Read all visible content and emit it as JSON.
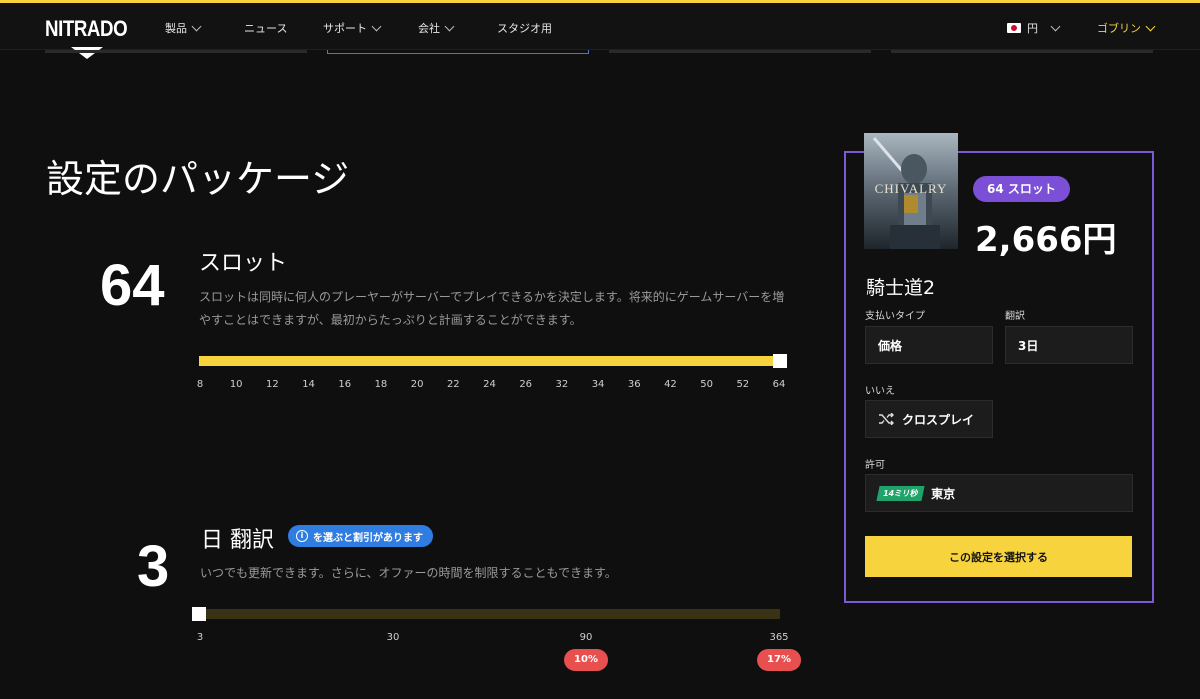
{
  "nav": {
    "logo": "NITRADO",
    "items": [
      {
        "label": "製品",
        "dropdown": true
      },
      {
        "label": "ニュース",
        "dropdown": false
      },
      {
        "label": "サポート",
        "dropdown": true
      },
      {
        "label": "会社",
        "dropdown": true
      },
      {
        "label": "スタジオ用",
        "dropdown": false
      }
    ],
    "currency": "円",
    "user": "ゴブリン",
    "accent_color": "#f7d33e"
  },
  "page_title": "設定のパッケージ",
  "slots": {
    "value": "64",
    "title": "スロット",
    "description_line1": "スロットは同時に何人のプレーヤーがサーバーでプレイできるかを決定します。将来的にゲームサーバーを増",
    "description_line2": "やすことはできますが、最初からたっぷりと計画することができます。",
    "ticks": [
      "8",
      "10",
      "12",
      "14",
      "16",
      "18",
      "20",
      "22",
      "24",
      "26",
      "32",
      "34",
      "36",
      "42",
      "50",
      "52",
      "64"
    ],
    "selected": "64",
    "fill_fraction": 1.0
  },
  "days": {
    "value": "3",
    "title": "日 翻訳",
    "info_badge": "を選ぶと割引があります",
    "description": "いつでも更新できます。さらに、オファーの時間を制限することもできます。",
    "ticks": [
      "3",
      "30",
      "90",
      "365"
    ],
    "selected": "3",
    "fill_fraction": 0.0,
    "discounts": [
      {
        "tick": "90",
        "label": "10%"
      },
      {
        "tick": "365",
        "label": "17%"
      }
    ]
  },
  "summary": {
    "slot_badge": "64 スロット",
    "price": "2,666円",
    "game_name": "騎士道2",
    "cover_text": "CHIVALRY",
    "payment_label": "支払いタイプ",
    "payment_value": "価格",
    "duration_label": "翻訳",
    "duration_value": "3日",
    "crossplay_label": "いいえ",
    "crossplay_value": "クロスプレイ",
    "location_label": "許可",
    "ping_badge": "14ミリ秒",
    "location_value": "東京",
    "cta_label": "この設定を選択する",
    "border_color": "#7b5ad6"
  }
}
